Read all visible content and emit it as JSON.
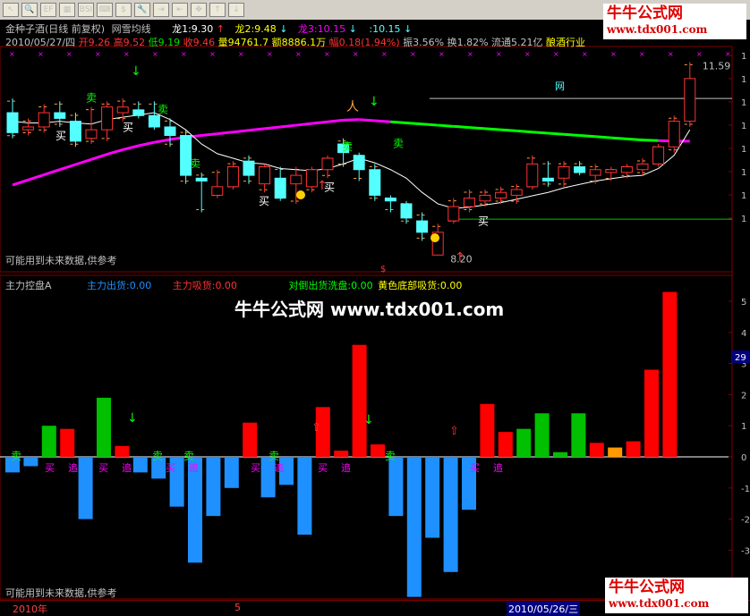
{
  "toolbar": {
    "icons": [
      "select-icon",
      "zoom-icon",
      "indicator-icon",
      "chart-icon",
      "bsi-icon",
      "shortcut-icon",
      "dollar-icon",
      "tools-icon",
      "import-icon",
      "export-icon",
      "crosshair-icon",
      "up-arrow-icon",
      "down-arrow-icon"
    ],
    "labels": [
      "↖",
      "🔍",
      "EF",
      "▦",
      "BSI",
      "⌨",
      "$",
      "🔧",
      "⇥",
      "⇤",
      "✥",
      "↑",
      "↓"
    ]
  },
  "logo": {
    "brand": "牛牛公式网",
    "url": "www.tdx001.com"
  },
  "header": {
    "stock": "金种子酒(日线 前复权)",
    "indicator": "网雪均线",
    "l1": "龙1:9.30",
    "l2": "龙2:9.48",
    "l3": "龙3:10.15",
    "l4": ":10.15",
    "date": "2010/05/27/四",
    "open": "开9.26",
    "high": "高9.52",
    "low": "低9.19",
    "close": "收9.46",
    "volume": "量94761.7",
    "amount": "额8886.1万",
    "change": "幅0.18(1.94%)",
    "amplitude": "振3.56%",
    "turnover": "换1.82%",
    "float": "流通5.21亿",
    "industry": "酿酒行业"
  },
  "lower_header": {
    "name": "主力控盘A",
    "out": "主力出货:0.00",
    "absorb": "主力吸货:0.00",
    "wash": "对倒出货洗盘:0.00",
    "bottom": "黄色底部吸货:0.00"
  },
  "watermark": "牛牛公式网 www.tdx001.com",
  "warning_text": "可能用到未来数据,供参考",
  "price_labels": {
    "high": "11.59",
    "low": "8.20",
    "net": "网"
  },
  "signals": {
    "buy": "买",
    "sell": "卖",
    "chase": "追"
  },
  "axis_labels": {
    "left": "2010年",
    "mid": "5",
    "date": "2010/05/26/三"
  },
  "lower_axis_readout": "29",
  "colors": {
    "up": "#ff3232",
    "down": "#54ffff",
    "ma_up": "#ff00ff",
    "ma_down": "#00ff00",
    "bar_pos": "#ff0000",
    "bar_neg": "#1e90ff",
    "bar_green": "#00c000",
    "bar_orange": "#ff9900"
  },
  "chart_data": [
    {
      "type": "candlestick",
      "candles": [
        {
          "o": 10.7,
          "h": 10.95,
          "l": 10.25,
          "c": 10.35
        },
        {
          "o": 10.4,
          "h": 10.6,
          "l": 10.3,
          "c": 10.45
        },
        {
          "o": 10.45,
          "h": 10.85,
          "l": 10.35,
          "c": 10.7
        },
        {
          "o": 10.7,
          "h": 10.9,
          "l": 10.45,
          "c": 10.6
        },
        {
          "o": 10.55,
          "h": 10.7,
          "l": 10.1,
          "c": 10.2
        },
        {
          "o": 10.25,
          "h": 10.8,
          "l": 10.15,
          "c": 10.4
        },
        {
          "o": 10.4,
          "h": 10.9,
          "l": 10.2,
          "c": 10.8
        },
        {
          "o": 10.7,
          "h": 10.95,
          "l": 10.55,
          "c": 10.8
        },
        {
          "o": 10.75,
          "h": 10.9,
          "l": 10.6,
          "c": 10.65
        },
        {
          "o": 10.65,
          "h": 10.9,
          "l": 10.4,
          "c": 10.45
        },
        {
          "o": 10.45,
          "h": 10.6,
          "l": 10.1,
          "c": 10.3
        },
        {
          "o": 10.3,
          "h": 10.4,
          "l": 9.45,
          "c": 9.6
        },
        {
          "o": 9.55,
          "h": 9.65,
          "l": 8.95,
          "c": 9.5
        },
        {
          "o": 9.25,
          "h": 9.7,
          "l": 9.2,
          "c": 9.4
        },
        {
          "o": 9.4,
          "h": 9.85,
          "l": 9.35,
          "c": 9.75
        },
        {
          "o": 9.85,
          "h": 9.95,
          "l": 9.45,
          "c": 9.6
        },
        {
          "o": 9.45,
          "h": 9.8,
          "l": 9.3,
          "c": 9.75
        },
        {
          "o": 9.55,
          "h": 9.75,
          "l": 9.15,
          "c": 9.2
        },
        {
          "o": 9.45,
          "h": 9.75,
          "l": 9.1,
          "c": 9.6
        },
        {
          "o": 9.4,
          "h": 9.75,
          "l": 9.3,
          "c": 9.7
        },
        {
          "o": 9.7,
          "h": 9.95,
          "l": 9.55,
          "c": 9.9
        },
        {
          "o": 10.15,
          "h": 10.25,
          "l": 9.75,
          "c": 10.0
        },
        {
          "o": 9.95,
          "h": 10.0,
          "l": 9.5,
          "c": 9.7
        },
        {
          "o": 9.7,
          "h": 9.8,
          "l": 9.15,
          "c": 9.25
        },
        {
          "o": 9.2,
          "h": 9.25,
          "l": 8.95,
          "c": 9.15
        },
        {
          "o": 9.1,
          "h": 9.15,
          "l": 8.75,
          "c": 8.85
        },
        {
          "o": 8.8,
          "h": 8.95,
          "l": 8.45,
          "c": 8.6
        },
        {
          "o": 8.2,
          "h": 8.75,
          "l": 8.2,
          "c": 8.6
        },
        {
          "o": 8.8,
          "h": 9.2,
          "l": 8.75,
          "c": 9.05
        },
        {
          "o": 9.05,
          "h": 9.35,
          "l": 8.95,
          "c": 9.2
        },
        {
          "o": 9.15,
          "h": 9.35,
          "l": 9.05,
          "c": 9.25
        },
        {
          "o": 9.2,
          "h": 9.4,
          "l": 9.1,
          "c": 9.3
        },
        {
          "o": 9.25,
          "h": 9.45,
          "l": 9.1,
          "c": 9.35
        },
        {
          "o": 9.4,
          "h": 9.95,
          "l": 9.35,
          "c": 9.8
        },
        {
          "o": 9.55,
          "h": 9.85,
          "l": 9.4,
          "c": 9.5
        },
        {
          "o": 9.55,
          "h": 9.85,
          "l": 9.4,
          "c": 9.75
        },
        {
          "o": 9.75,
          "h": 9.85,
          "l": 9.6,
          "c": 9.65
        },
        {
          "o": 9.6,
          "h": 9.8,
          "l": 9.45,
          "c": 9.7
        },
        {
          "o": 9.65,
          "h": 9.75,
          "l": 9.5,
          "c": 9.7
        },
        {
          "o": 9.65,
          "h": 9.8,
          "l": 9.55,
          "c": 9.75
        },
        {
          "o": 9.7,
          "h": 9.9,
          "l": 9.6,
          "c": 9.8
        },
        {
          "o": 9.8,
          "h": 10.15,
          "l": 9.75,
          "c": 10.1
        },
        {
          "o": 10.1,
          "h": 10.65,
          "l": 10.0,
          "c": 10.55
        },
        {
          "o": 10.55,
          "h": 11.59,
          "l": 10.45,
          "c": 11.3
        }
      ],
      "ylim": [
        8.0,
        11.8
      ],
      "ma_long": [
        9.43,
        9.52,
        9.61,
        9.7,
        9.79,
        9.88,
        9.97,
        10.05,
        10.12,
        10.18,
        10.23,
        10.27,
        10.3,
        10.33,
        10.36,
        10.39,
        10.42,
        10.45,
        10.48,
        10.51,
        10.54,
        10.57,
        10.58,
        10.56,
        10.54,
        10.52,
        10.5,
        10.48,
        10.46,
        10.44,
        10.42,
        10.4,
        10.38,
        10.36,
        10.34,
        10.32,
        10.3,
        10.28,
        10.26,
        10.24,
        10.22,
        10.21,
        10.2,
        10.2
      ],
      "ma_short": [
        10.55,
        10.52,
        10.52,
        10.55,
        10.52,
        10.5,
        10.58,
        10.62,
        10.66,
        10.7,
        10.58,
        10.4,
        10.15,
        9.98,
        9.9,
        9.82,
        9.8,
        9.72,
        9.7,
        9.68,
        9.72,
        9.8,
        9.9,
        9.82,
        9.7,
        9.55,
        9.3,
        9.1,
        9.02,
        9.04,
        9.08,
        9.12,
        9.18,
        9.24,
        9.3,
        9.38,
        9.44,
        9.5,
        9.54,
        9.58,
        9.6,
        9.72,
        9.95,
        10.4
      ],
      "resistance": 10.95,
      "support": 8.83
    },
    {
      "type": "bar",
      "values": [
        -0.5,
        -0.3,
        1.0,
        0.9,
        -2.0,
        1.9,
        0.35,
        -0.5,
        -0.7,
        -1.6,
        -3.4,
        -1.9,
        -1.0,
        1.1,
        -1.3,
        -0.9,
        -2.5,
        1.6,
        0.2,
        3.6,
        0.4,
        -1.9,
        -4.5,
        -2.6,
        -3.7,
        -1.7,
        1.7,
        0.8,
        0.9,
        1.4,
        0.15,
        1.4,
        0.45,
        0.3,
        0.5,
        2.8,
        5.3
      ],
      "highlight": [
        33
      ],
      "ylim": [
        -3.9,
        5.6
      ],
      "yticks": [
        5,
        4,
        3,
        2,
        1,
        0,
        -1,
        -2,
        -3
      ]
    }
  ]
}
